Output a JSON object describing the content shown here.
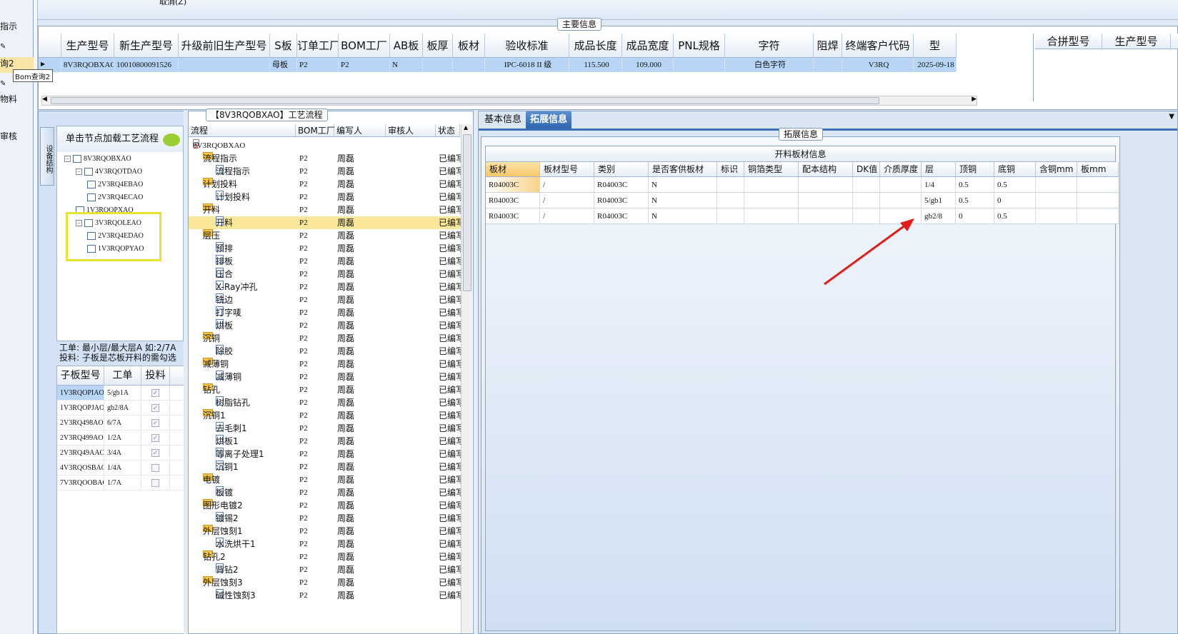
{
  "left_nav": {
    "items": [
      "指示",
      "询2",
      "物料",
      "审核"
    ],
    "tooltip": "Bom查询2"
  },
  "top": {
    "crumb": "取消(Z)",
    "panel_title": "主要信息",
    "columns": [
      "生产型号",
      "新生产型号",
      "升级前旧生产型号",
      "S板",
      "订单工厂",
      "BOM工厂",
      "AB板",
      "板厚",
      "板材",
      "验收标准",
      "成品长度",
      "成品宽度",
      "PNL规格",
      "字符",
      "阻焊",
      "终端客户代码",
      "型"
    ],
    "row": [
      "8V3RQOBXAO",
      "10010800091526",
      "",
      "母板",
      "P2",
      "P2",
      "N",
      "",
      "",
      "IPC-6018 II 级",
      "115.500",
      "109.000",
      "",
      "白色字符",
      "",
      "V3RQ",
      "2025-09-18"
    ],
    "right_columns": [
      "合拼型号",
      "生产型号"
    ]
  },
  "tree": {
    "side_tab": "设备结构",
    "header": "单击节点加载工艺流程",
    "nodes": [
      {
        "label": "8V3RQOBXAO"
      },
      {
        "label": "4V3RQOTDAO"
      },
      {
        "label": "2V3RQ4EBAO"
      },
      {
        "label": "2V3RQ4ECAO"
      },
      {
        "label": "1V3RQOPXAO"
      },
      {
        "label": "3V3RQOLEAO"
      },
      {
        "label": "2V3RQ4EDAO"
      },
      {
        "label": "1V3RQOPYAO"
      }
    ],
    "note_line1": "工单: 最小层/最大层A 如:2/7A",
    "note_line2": "投料: 子板是芯板开料的需勾选"
  },
  "subgrid": {
    "columns": [
      "子板型号",
      "工单",
      "投料"
    ],
    "rows": [
      {
        "model": "1V3RQOPIAO",
        "order": "5/gb1A",
        "checked": true
      },
      {
        "model": "1V3RQOPJAO",
        "order": "gb2/8A",
        "checked": true
      },
      {
        "model": "2V3RQ498AO",
        "order": "6/7A",
        "checked": true
      },
      {
        "model": "2V3RQ499AO",
        "order": "1/2A",
        "checked": true
      },
      {
        "model": "2V3RQ49AAO",
        "order": "3/4A",
        "checked": true
      },
      {
        "model": "4V3RQOSBAO",
        "order": "1/4A",
        "checked": false
      },
      {
        "model": "7V3RQOOBAO",
        "order": "1/7A",
        "checked": false
      }
    ]
  },
  "process": {
    "panel_title": "【8V3RQOBXAO】工艺流程",
    "columns": [
      "流程",
      "BOM工厂",
      "编写人",
      "审核人",
      "状态"
    ],
    "root": "8V3RQOBXAO",
    "factory": "P2",
    "author": "周磊",
    "status": "已编写",
    "rows": [
      {
        "name": "流程指示",
        "level": 1
      },
      {
        "name": "流程指示",
        "level": 2
      },
      {
        "name": "计划投料",
        "level": 1
      },
      {
        "name": "计划投料",
        "level": 2
      },
      {
        "name": "开料",
        "level": 1
      },
      {
        "name": "开料",
        "level": 2,
        "selected": true
      },
      {
        "name": "层压",
        "level": 1
      },
      {
        "name": "预排",
        "level": 2
      },
      {
        "name": "排板",
        "level": 2
      },
      {
        "name": "压合",
        "level": 2
      },
      {
        "name": "X-Ray冲孔",
        "level": 2
      },
      {
        "name": "铣边",
        "level": 2
      },
      {
        "name": "打字唛",
        "level": 2
      },
      {
        "name": "烘板",
        "level": 2
      },
      {
        "name": "沉铜",
        "level": 1
      },
      {
        "name": "除胶",
        "level": 2
      },
      {
        "name": "减薄铜",
        "level": 1
      },
      {
        "name": "减薄铜",
        "level": 2
      },
      {
        "name": "钻孔",
        "level": 1
      },
      {
        "name": "树脂钻孔",
        "level": 2
      },
      {
        "name": "沉铜1",
        "level": 1
      },
      {
        "name": "去毛刺1",
        "level": 2
      },
      {
        "name": "烘板1",
        "level": 2
      },
      {
        "name": "等离子处理1",
        "level": 2
      },
      {
        "name": "沉铜1",
        "level": 2
      },
      {
        "name": "电镀",
        "level": 1
      },
      {
        "name": "板镀",
        "level": 2
      },
      {
        "name": "图形电镀2",
        "level": 1
      },
      {
        "name": "镀锡2",
        "level": 2
      },
      {
        "name": "外层蚀刻1",
        "level": 1
      },
      {
        "name": "水洗烘干1",
        "level": 2
      },
      {
        "name": "钻孔2",
        "level": 1
      },
      {
        "name": "背钻2",
        "level": 2
      },
      {
        "name": "外层蚀刻3",
        "level": 1
      },
      {
        "name": "碱性蚀刻3",
        "level": 2
      }
    ]
  },
  "right": {
    "tabs": [
      "基本信息",
      "拓展信息"
    ],
    "active_tab": 1,
    "frame_title": "拓展信息",
    "grid_title": "开料板材信息",
    "columns": [
      "板材",
      "板材型号",
      "类别",
      "是否客供板材",
      "标识",
      "铜箔类型",
      "配本结构",
      "DK值",
      "介质厚度",
      "层",
      "顶铜",
      "底铜",
      "含铜mm",
      "板mm"
    ],
    "rows": [
      [
        "R04003C",
        "/",
        "R04003C",
        "N",
        "",
        "",
        "",
        "",
        "",
        "1/4",
        "0.5",
        "0.5",
        "",
        ""
      ],
      [
        "R04003C",
        "/",
        "R04003C",
        "N",
        "",
        "",
        "",
        "",
        "",
        "5/gb1",
        "0.5",
        "0",
        "",
        ""
      ],
      [
        "R04003C",
        "/",
        "R04003C",
        "N",
        "",
        "",
        "",
        "",
        "",
        "gb2/8",
        "0",
        "0.5",
        "",
        ""
      ]
    ]
  },
  "colors": {
    "accent_blue": "#2f66b0",
    "highlight_yellow": "#e5e52e",
    "arrow_red": "#e21b1b",
    "selected_row": "#b8d5f5"
  }
}
